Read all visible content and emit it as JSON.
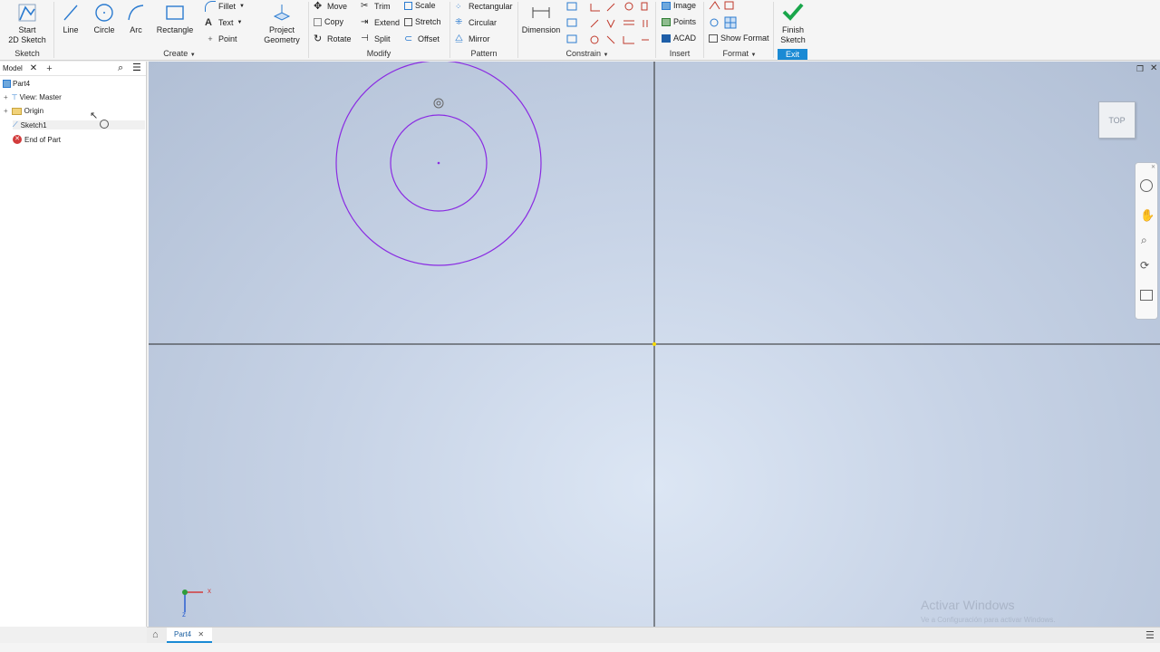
{
  "ribbon": {
    "sketch_group": {
      "start_sketch": "Start\n2D Sketch",
      "label": "Sketch"
    },
    "create_group": {
      "line": "Line",
      "circle": "Circle",
      "arc": "Arc",
      "rectangle": "Rectangle",
      "fillet": "Fillet",
      "text": "Text",
      "point": "Point",
      "project_geometry": "Project\nGeometry",
      "label": "Create"
    },
    "modify_group": {
      "move": "Move",
      "copy": "Copy",
      "rotate": "Rotate",
      "trim": "Trim",
      "extend": "Extend",
      "split": "Split",
      "scale": "Scale",
      "stretch": "Stretch",
      "offset": "Offset",
      "label": "Modify"
    },
    "pattern_group": {
      "rectangular": "Rectangular",
      "circular": "Circular",
      "mirror": "Mirror",
      "label": "Pattern"
    },
    "constrain_group": {
      "dimension": "Dimension",
      "label": "Constrain"
    },
    "insert_group": {
      "image": "Image",
      "points": "Points",
      "acad": "ACAD",
      "label": "Insert"
    },
    "format_group": {
      "show_format": "Show Format",
      "label": "Format"
    },
    "exit_group": {
      "finish_sketch": "Finish\nSketch",
      "label": "Exit"
    }
  },
  "browser": {
    "tab_label": "Model",
    "items": [
      {
        "label": "Part4"
      },
      {
        "label": "View: Master"
      },
      {
        "label": "Origin"
      },
      {
        "label": "Sketch1"
      },
      {
        "label": "End of Part"
      }
    ]
  },
  "viewport": {
    "viewcube_label": "TOP",
    "triad_x": "x",
    "triad_z": "z",
    "watermark_title": "Activar Windows",
    "watermark_sub": "Ve a Configuración para activar Windows."
  },
  "document_tabs": [
    {
      "label": "Part4"
    }
  ],
  "colors": {
    "sketch_curve": "#8a2be2",
    "exit_bg": "#1a8ad4",
    "finish_check": "#19a64b"
  }
}
